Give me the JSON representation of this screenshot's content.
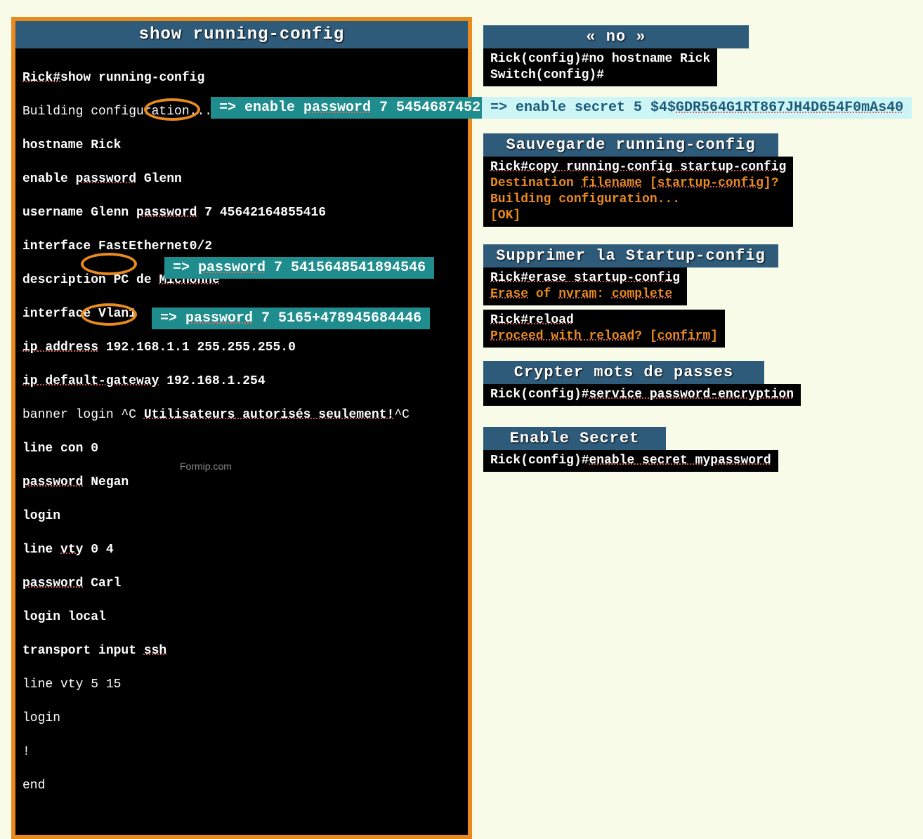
{
  "main": {
    "title": "show running-config",
    "lines": {
      "l1a": "Rick#",
      "l1b": "show running-config",
      "l2": "Building configuration...",
      "l3": "hostname Rick",
      "l4a": "enable ",
      "l4b": "password",
      "l4c": " Glenn",
      "l5a": "username Glenn ",
      "l5b": "password",
      "l5c": " 7 45642164855416",
      "l6": "interface FastEthernet0/2",
      "l7a": "description PC de ",
      "l7b": "Michonne",
      "l8": "interface Vlan1",
      "l9a": "ip",
      "l9b": " address",
      "l9c": " 192.168.1.1 255.255.255.0",
      "l10a": "ip",
      "l10b": " default-gateway",
      "l10c": " 192.168.1.254",
      "l11a": "banner login ^C ",
      "l11b": "Utilisateurs",
      "l11c": " autorisés",
      "l11d": " seulement!",
      "l11e": "^C",
      "l12": "line con 0",
      "l13a": "password",
      "l13b": " Negan",
      "l14": "login",
      "l15a": "line ",
      "l15b": "vty",
      "l15c": " 0 4",
      "l16a": "password",
      "l16b": " Carl",
      "l17": "login local",
      "l18a": "transport input ",
      "l18b": "ssh",
      "l19": "line vty 5 15",
      "l20": "login",
      "l21": "!",
      "l22": "end"
    }
  },
  "callouts": {
    "c1a": "=> enable ",
    "c1b": "password",
    "c1c": " 7 5454687452",
    "c2a": "=> enable secret 5 $4$",
    "c2b": "GDR564G1RT867JH4D654F0mAs40",
    "c3a": "=> ",
    "c3b": "password",
    "c3c": " 7 5415648541894546",
    "c4a": "=> ",
    "c4b": "password",
    "c4c": " 7 5165+478945684446"
  },
  "side": {
    "no_title": "« no »",
    "no_l1a": "Rick(config)#",
    "no_l1b": "no hostname Rick",
    "no_l2": "Switch(config)#",
    "save_title": "Sauvegarde running-config",
    "save_l1a": "Rick#",
    "save_l1b": "copy",
    "save_l1c": " running-config",
    "save_l1d": " startup-config",
    "save_l2a": "Destination ",
    "save_l2b": "filename",
    "save_l2c": " [",
    "save_l2d": "startup-config",
    "save_l2e": "]?",
    "save_l3": "Building configuration...",
    "save_l4": "[OK]",
    "del_title": "Supprimer la Startup-config",
    "del_l1a": "Rick#",
    "del_l1b": "erase",
    "del_l1c": " startup-config",
    "del_l2a": "Erase",
    "del_l2b": " of ",
    "del_l2c": "nvram",
    "del_l2d": ": ",
    "del_l2e": "complete",
    "del2_l1a": "Rick#",
    "del2_l1b": "reload",
    "del2_l2a": "Proceed",
    "del2_l2b": " with",
    "del2_l2c": " reload",
    "del2_l2d": "? [",
    "del2_l2e": "confirm",
    "del2_l2f": "]",
    "crypt_title": "Crypter mots de passes",
    "crypt_l1a": "Rick(config)#",
    "crypt_l1b": "service",
    "crypt_l1c": " password-encryption",
    "secret_title": "Enable Secret",
    "secret_l1a": "Rick(config)#",
    "secret_l1b": "enable",
    "secret_l1c": " secret",
    "secret_l1d": " mypassword"
  },
  "watermark": "Formip.com"
}
